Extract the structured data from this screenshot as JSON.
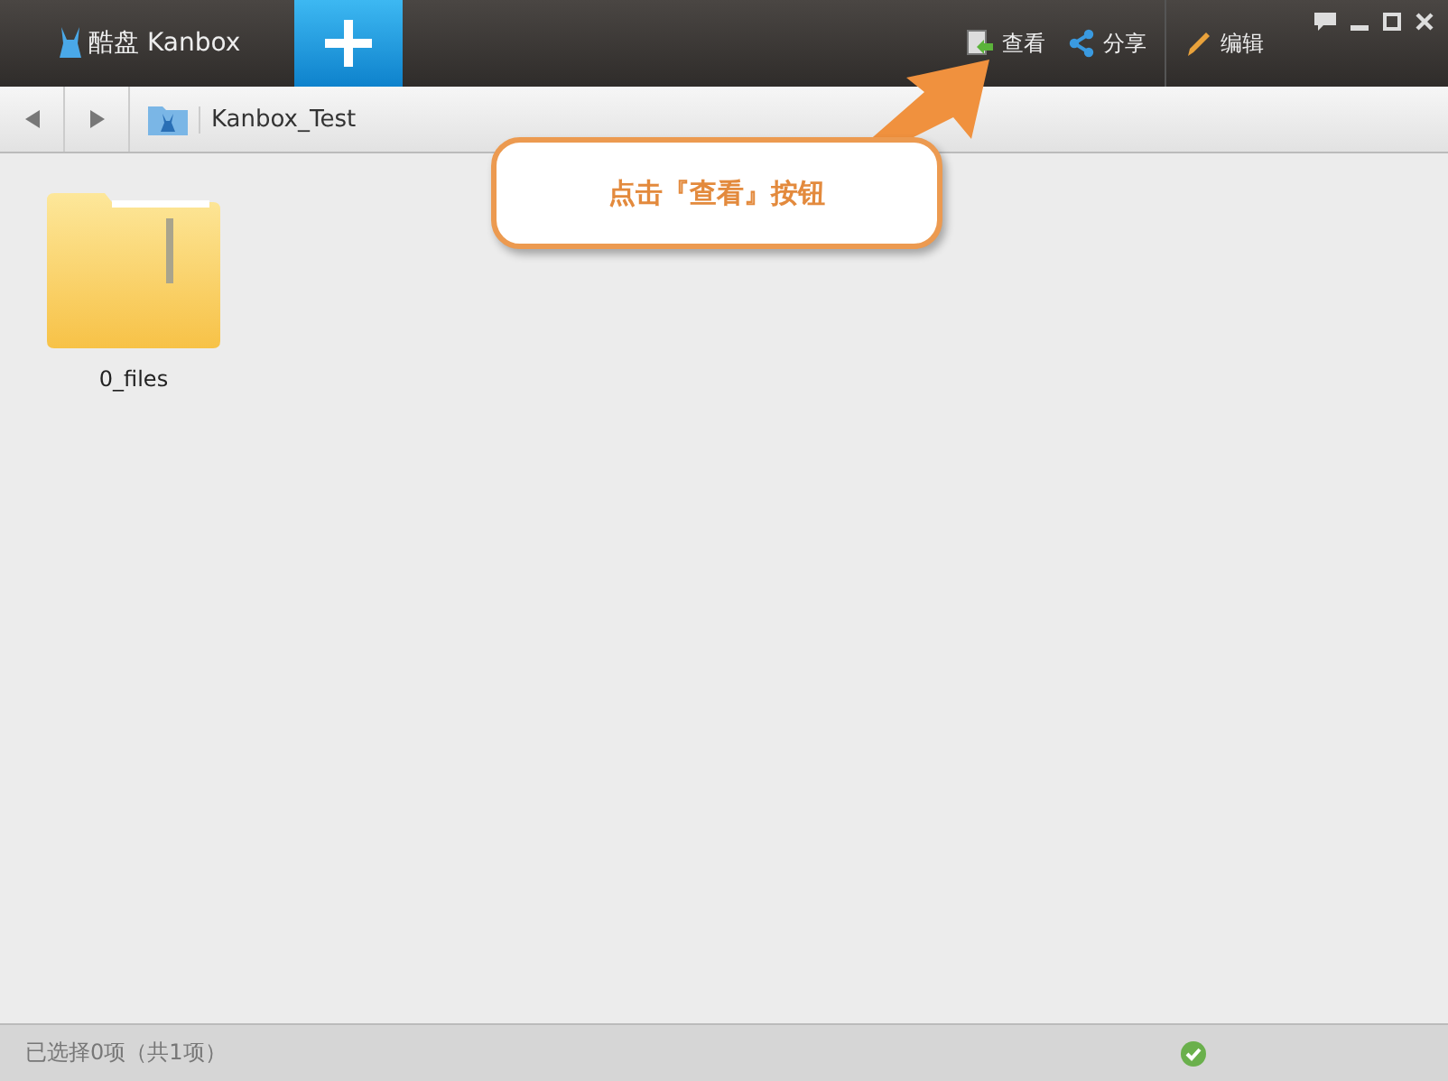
{
  "app": {
    "title": "酷盘 Kanbox"
  },
  "toolbar": [
    {
      "kind": "view",
      "label": "查看"
    },
    {
      "kind": "share",
      "label": "分享"
    },
    {
      "kind": "edit",
      "label": "编辑"
    }
  ],
  "breadcrumb": {
    "path": "Kanbox_Test"
  },
  "files": [
    {
      "name": "0_files"
    }
  ],
  "callout": {
    "text": "点击『查看』按钮"
  },
  "status_bar": {
    "text": "已选择0项（共1项）"
  }
}
